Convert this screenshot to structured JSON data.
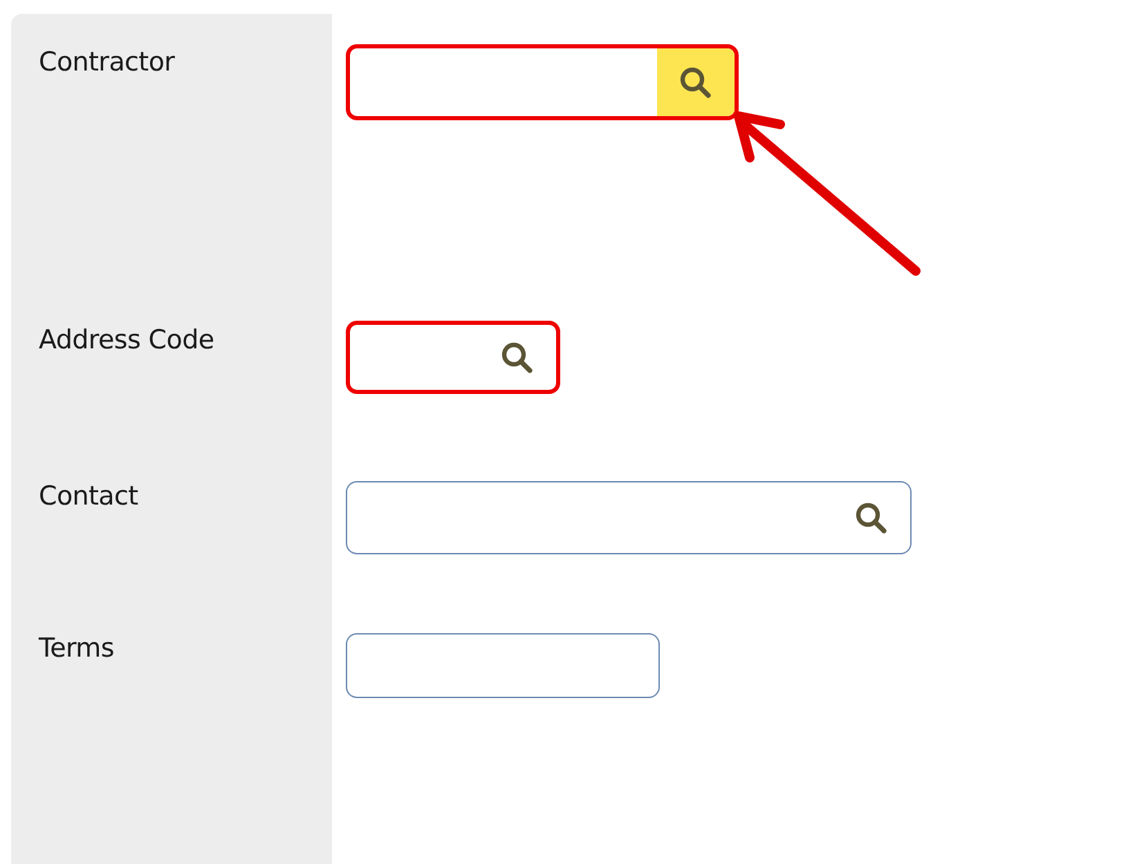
{
  "form": {
    "fields": [
      {
        "label": "Contractor",
        "kind": "lookup",
        "required": true,
        "lookup_highlighted": true
      },
      {
        "label": "Address Code",
        "kind": "lookup",
        "required": true,
        "lookup_highlighted": false
      },
      {
        "label": "Contact",
        "kind": "lookup",
        "required": false,
        "lookup_highlighted": false
      },
      {
        "label": "Terms",
        "kind": "text",
        "required": false
      }
    ]
  }
}
